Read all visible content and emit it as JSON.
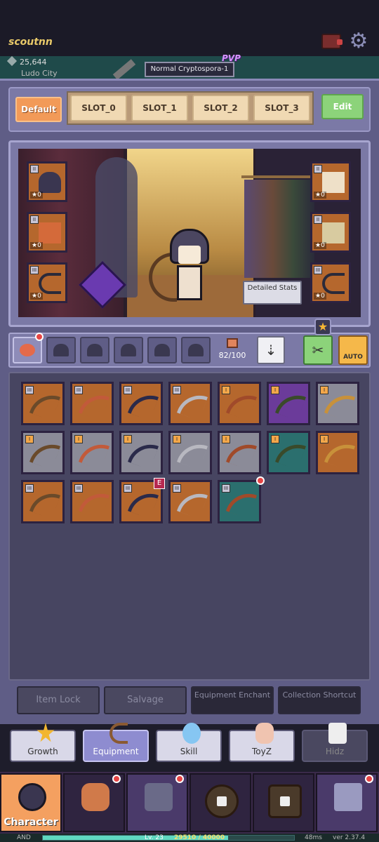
{
  "header": {
    "player_name": "scoutnn",
    "currency": "25,644",
    "location": "Ludo City",
    "mode": "Normal Cryptospora-1",
    "pvp_badge": "PVP"
  },
  "loadout": {
    "default_label": "Default",
    "slots": [
      "SLOT_0",
      "SLOT_1",
      "SLOT_2",
      "SLOT_3"
    ],
    "edit_label": "Edit"
  },
  "showcase": {
    "detailed_stats": "Detailed Stats",
    "left_slots": [
      {
        "tier": "II",
        "stars": "★0",
        "item": "helmet"
      },
      {
        "tier": "II",
        "stars": "★0",
        "item": "armor"
      },
      {
        "tier": "III",
        "stars": "★0",
        "item": "bow"
      }
    ],
    "right_slots": [
      {
        "tier": "II",
        "stars": "★0",
        "item": "shirt"
      },
      {
        "tier": "II",
        "stars": "★0",
        "item": "boots"
      },
      {
        "tier": "III",
        "stars": "★0",
        "item": "bow"
      }
    ]
  },
  "filters": {
    "tabs": [
      "weapon-icon",
      "helmet-icon",
      "glasses-icon",
      "hat-icon",
      "armor-icon",
      "shoes-icon"
    ],
    "capacity": "82/100",
    "auto_label": "AUTO"
  },
  "inventory": {
    "items": [
      {
        "tier": "III",
        "bg": "orange"
      },
      {
        "tier": "III",
        "bg": "orange"
      },
      {
        "tier": "III",
        "bg": "orange"
      },
      {
        "tier": "III",
        "bg": "orange"
      },
      {
        "tier": "I",
        "bg": "orange"
      },
      {
        "tier": "I",
        "bg": "purple"
      },
      {
        "tier": "I",
        "bg": "grey"
      },
      {
        "tier": "I",
        "bg": "grey"
      },
      {
        "tier": "I",
        "bg": "grey"
      },
      {
        "tier": "I",
        "bg": "grey"
      },
      {
        "tier": "I",
        "bg": "grey"
      },
      {
        "tier": "I",
        "bg": "grey"
      },
      {
        "tier": "I",
        "bg": "teal"
      },
      {
        "tier": "I",
        "bg": "orange"
      },
      {
        "tier": "III",
        "bg": "orange"
      },
      {
        "tier": "III",
        "bg": "orange"
      },
      {
        "tier": "III",
        "bg": "orange",
        "badge": "E"
      },
      {
        "tier": "III",
        "bg": "orange"
      },
      {
        "tier": "III",
        "bg": "teal",
        "new": true
      }
    ]
  },
  "actions": {
    "item_lock": "Item Lock",
    "salvage": "Salvage",
    "equipment_enchant": "Equipment Enchant",
    "collection_shortcut": "Collection Shortcut"
  },
  "categories": [
    "Growth",
    "Equipment",
    "Skill",
    "ToyZ",
    "Hidz"
  ],
  "nav": {
    "character": "Character"
  },
  "footer": {
    "left": "AND",
    "level": "Lv. 23",
    "exp": "29510 / 40000",
    "exp_fraction": 0.738,
    "ping": "48ms",
    "version": "ver 2.37.4"
  },
  "colors": {
    "orange_item": "#b5672d",
    "purple_item": "#6b3b9a",
    "teal_item": "#2b6f6e",
    "grey_item": "#8b8b98",
    "active_tab": "#8e8cd0",
    "accent_gold": "#e8c969"
  }
}
